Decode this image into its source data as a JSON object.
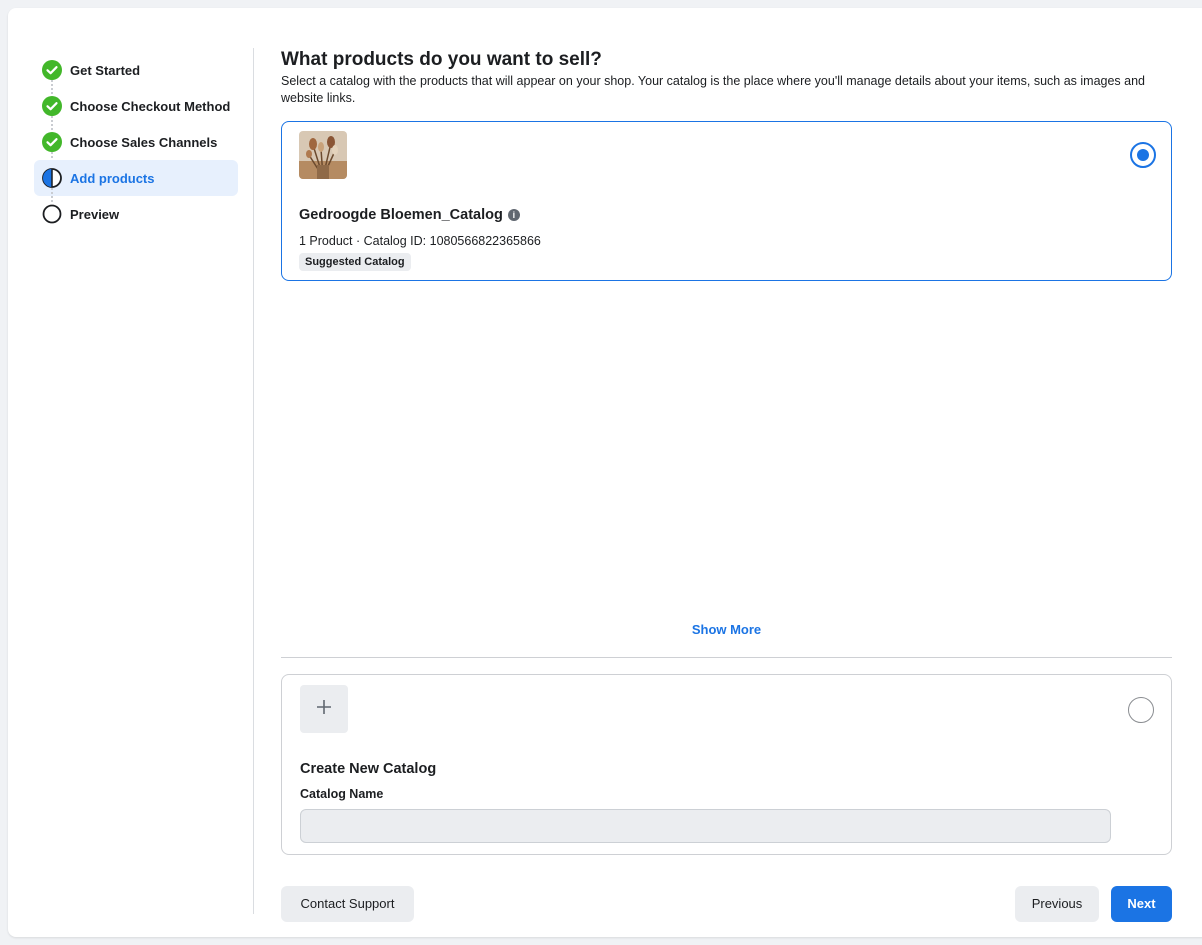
{
  "colors": {
    "accent": "#1b74e4",
    "success": "#42b72a",
    "page_bg": "#f0f2f5"
  },
  "stepper": {
    "steps": [
      {
        "label": "Get Started",
        "state": "complete",
        "icon": "check-circle-icon"
      },
      {
        "label": "Choose Checkout Method",
        "state": "complete",
        "icon": "check-circle-icon"
      },
      {
        "label": "Choose Sales Channels",
        "state": "complete",
        "icon": "check-circle-icon"
      },
      {
        "label": "Add products",
        "state": "active",
        "icon": "half-circle-icon"
      },
      {
        "label": "Preview",
        "state": "pending",
        "icon": "empty-circle-icon"
      }
    ]
  },
  "main": {
    "title": "What products do you want to sell?",
    "subtitle": "Select a catalog with the products that will appear on your shop. Your catalog is the place where you'll manage details about your items, such as images and website links."
  },
  "catalog": {
    "name": "Gedroogde Bloemen_Catalog",
    "meta": "1 Product · Catalog ID: 1080566822365866",
    "badge": "Suggested Catalog",
    "selected": true
  },
  "show_more": "Show More",
  "new_catalog": {
    "title": "Create New Catalog",
    "field_label": "Catalog Name",
    "value": "",
    "selected": false
  },
  "footer": {
    "contact_support": "Contact Support",
    "previous": "Previous",
    "next": "Next"
  }
}
